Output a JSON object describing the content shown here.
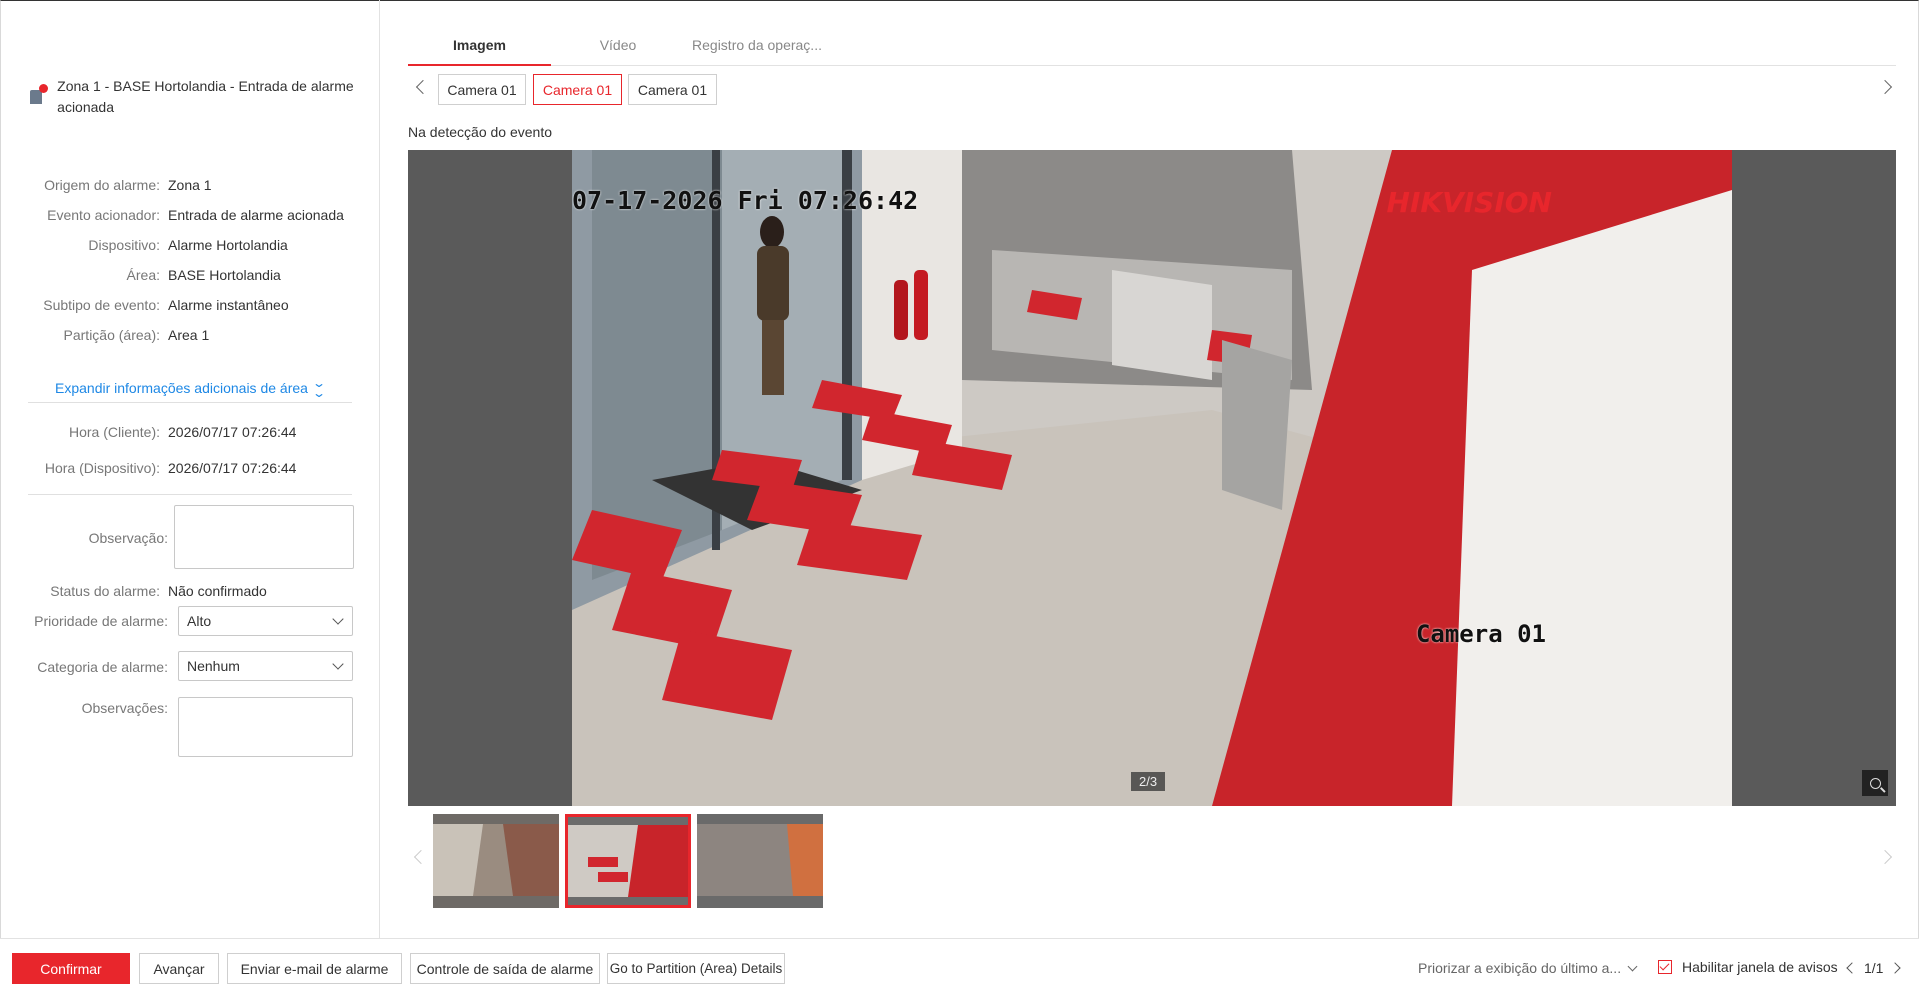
{
  "alarm": {
    "title": "Zona 1 - BASE Hortolandia - Entrada de alarme acionada",
    "details": [
      {
        "label": "Origem do alarme:",
        "value": "Zona 1"
      },
      {
        "label": "Evento acionador:",
        "value": "Entrada de alarme acionada"
      },
      {
        "label": "Dispositivo:",
        "value": "Alarme Hortolandia"
      },
      {
        "label": "Área:",
        "value": "BASE Hortolandia"
      },
      {
        "label": "Subtipo de evento:",
        "value": "Alarme instantâneo"
      },
      {
        "label": "Partição (área):",
        "value": "Area 1"
      }
    ],
    "expand_label": "Expandir informações adicionais de área",
    "time_client_label": "Hora (Cliente):",
    "time_client": "2026/07/17 07:26:44",
    "time_device_label": "Hora (Dispositivo):",
    "time_device": "2026/07/17 07:26:44",
    "observation_label": "Observação:",
    "status_label": "Status do alarme:",
    "status_value": "Não confirmado",
    "priority_label": "Prioridade de alarme:",
    "priority_value": "Alto",
    "category_label": "Categoria de alarme:",
    "category_value": "Nenhum",
    "remarks_label": "Observações:"
  },
  "tabs": [
    {
      "label": "Imagem",
      "active": true
    },
    {
      "label": "Vídeo",
      "active": false
    },
    {
      "label": "Registro da operaç...",
      "active": false
    }
  ],
  "cameras": [
    {
      "label": "Camera 01",
      "active": false
    },
    {
      "label": "Camera 01",
      "active": true
    },
    {
      "label": "Camera 01",
      "active": false
    }
  ],
  "viewer": {
    "caption": "Na detecção do evento",
    "osd_time": "07-17-2026 Fri 07:26:42",
    "osd_brand": "HIKVISION",
    "osd_camera": "Camera 01",
    "counter": "2/3"
  },
  "bottom": {
    "confirm": "Confirmar",
    "next": "Avançar",
    "email": "Enviar e-mail de alarme",
    "output": "Controle de saída de alarme",
    "partition": "Go to Partition (Area) Details",
    "prioritize": "Priorizar a exibição do último a...",
    "enable_popup": "Habilitar janela de avisos",
    "enable_popup_checked": true,
    "pager": "1/1"
  },
  "colors": {
    "accent": "#e8262c",
    "link": "#1e88e5"
  }
}
